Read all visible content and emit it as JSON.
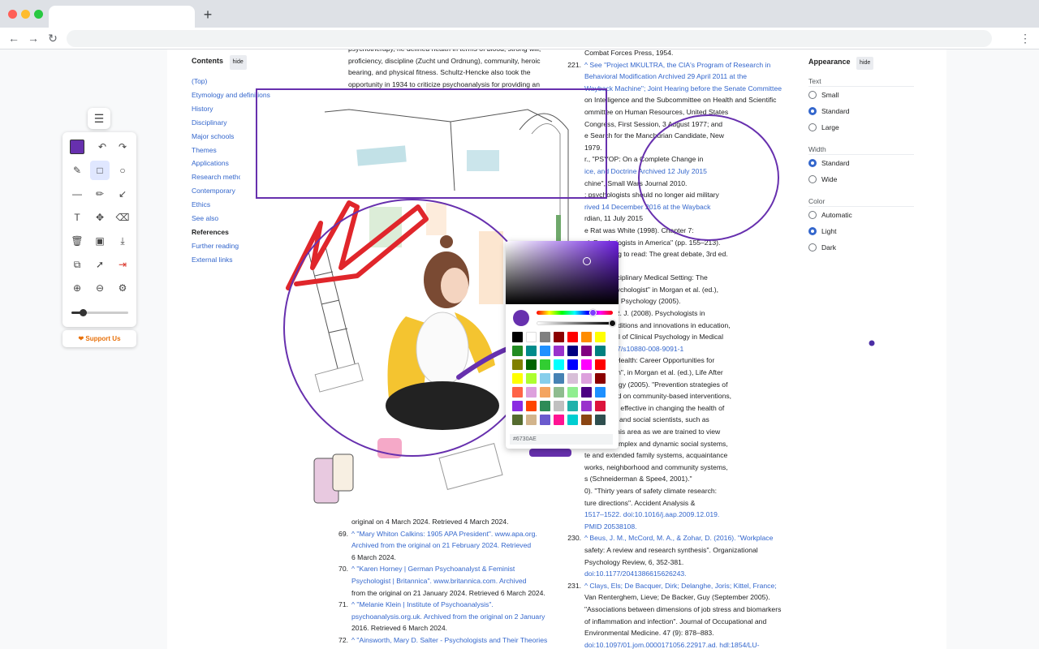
{
  "browser": {
    "new_tab_glyph": "+",
    "back_glyph": "←",
    "forward_glyph": "→",
    "reload_glyph": "↻",
    "menu_glyph": "⋮",
    "dot_colors": [
      "#ff5f57",
      "#febc2e",
      "#28c840"
    ]
  },
  "toc": {
    "title": "Contents",
    "hide_label": "hide",
    "items": [
      {
        "label": "(Top)",
        "chevron": false
      },
      {
        "label": "Etymology and definitions",
        "chevron": false
      },
      {
        "label": "History",
        "chevron": true
      },
      {
        "label": "Disciplinary",
        "chevron": true
      },
      {
        "label": "Major schools",
        "chevron": true
      },
      {
        "label": "Themes",
        "chevron": true
      },
      {
        "label": "Applications",
        "chevron": true
      },
      {
        "label": "Research methods",
        "chevron": true
      },
      {
        "label": "Contemporary",
        "chevron": true
      },
      {
        "label": "Ethics",
        "chevron": true
      },
      {
        "label": "See also",
        "chevron": false
      },
      {
        "label": "References",
        "chevron": true
      },
      {
        "label": "Further reading",
        "chevron": false
      },
      {
        "label": "External links",
        "chevron": false
      }
    ]
  },
  "left_col_top": [
    "psychotherapy, he defined health in terms of blood, strong will,",
    "proficiency, discipline (Zucht und Ordnung), community, heroic",
    "bearing, and physical fitness. Schultz-Hencke also took the",
    "opportunity in 1934 to criticize psychoanalysis for providing an"
  ],
  "left_col_bottom": [
    {
      "num": "",
      "text": "original on 4 March 2024. Retrieved 4 March 2024."
    },
    {
      "num": "69.",
      "text": "^ \"Mary Whiton Calkins: 1905 APA President\". www.apa.org."
    },
    {
      "num": "",
      "text": "Archived from the original on 21 February 2024. Retrieved"
    },
    {
      "num": "",
      "text": "6 March 2024."
    },
    {
      "num": "70.",
      "text": "^ \"Karen Horney | German Psychoanalyst & Feminist"
    },
    {
      "num": "",
      "text": "Psychologist | Britannica\". www.britannica.com. Archived"
    },
    {
      "num": "",
      "text": "from the original on 21 January 2024. Retrieved 6 March 2024."
    },
    {
      "num": "71.",
      "text": "^ \"Melanie Klein | Institute of Psychoanalysis\"."
    },
    {
      "num": "",
      "text": "psychoanalysis.org.uk. Archived from the original on 2 January"
    },
    {
      "num": "",
      "text": "2016. Retrieved 6 March 2024."
    },
    {
      "num": "72.",
      "text": "^ \"Ainsworth, Mary D. Salter - Psychologists and Their Theories"
    }
  ],
  "right_col": [
    {
      "num": "",
      "text": "Combat Forces Press, 1954."
    },
    {
      "num": "221.",
      "text": "^ See \"Project MKULTRA, the CIA's Program of Research in"
    },
    {
      "num": "",
      "text": "Behavioral Modification Archived 29 April 2011 at the"
    },
    {
      "num": "",
      "text": "Wayback Machine\"; Joint Hearing before the Senate Committee"
    },
    {
      "num": "",
      "text": "on Intelligence and the Subcommittee on Health and Scientific"
    },
    {
      "num": "",
      "text": "ommittee on Human Resources, United States"
    },
    {
      "num": "",
      "text": "Congress, First Session, 3 August 1977; and"
    },
    {
      "num": "",
      "text": "e Search for the Manchurian Candidate, New"
    },
    {
      "num": "",
      "text": "1979."
    },
    {
      "num": "",
      "text": "r., \"PSYOP: On a Complete Change in"
    },
    {
      "num": "",
      "text": "ice, and Doctrine Archived 12 July 2015"
    },
    {
      "num": "",
      "text": "chine\", Small Wars Journal 2010."
    },
    {
      "num": "",
      "text": ": psychologists should no longer aid military"
    },
    {
      "num": "",
      "text": "rived 14 December 2016 at the Wayback"
    },
    {
      "num": "",
      "text": "rdian, 11 July 2015"
    },
    {
      "num": "",
      "text": "e Rat was White (1998). Chapter 7:"
    },
    {
      "num": "",
      "text": "ck Psychologists in America\" (pp. 155–213)."
    },
    {
      "num": "",
      "text": "5). Learning to read: The great debate, 3rd ed."
    },
    {
      "num": "",
      "text": "urt Brace."
    },
    {
      "num": "",
      "text": "y, \"Interdisciplinary Medical Setting: The"
    },
    {
      "num": "",
      "text": " Health Psychologist\" in Morgan et al. (ed.),"
    },
    {
      "num": "",
      "text": "e School in Psychology (2005)."
    },
    {
      "num": "",
      "text": "& Seime, R. J. (2008). Psychologists in"
    },
    {
      "num": "",
      "text": "enters: Traditions and innovations in education,"
    },
    {
      "num": "",
      "text": "ice. Journal of Clinical Psychology in Medical"
    },
    {
      "num": "",
      "text": "doi:10.1007/s10880-008-9091-1"
    },
    {
      "num": "",
      "text": "n, \"Public Health: Career Opportunities for"
    },
    {
      "num": "",
      "text": "ublic Health\", in Morgan et al. (ed.), Life After"
    },
    {
      "num": "",
      "text": "n Psychology (2005). \"Prevention strategies of"
    },
    {
      "num": "",
      "text": "oncentrated on community-based interventions,"
    },
    {
      "num": "",
      "text": "hown to be effective in changing the health of"
    },
    {
      "num": "",
      "text": "Behavioral and social scientists, such as"
    },
    {
      "num": "",
      "text": "helpful in this area as we are trained to view"
    },
    {
      "num": "",
      "text": "nging to complex and dynamic social systems,"
    },
    {
      "num": "",
      "text": "te and extended family systems, acquaintance"
    },
    {
      "num": "",
      "text": "works, neighborhood and community systems,"
    },
    {
      "num": "",
      "text": "s (Schneiderman & Spee4, 2001).\""
    },
    {
      "num": "",
      "text": "0). \"Thirty years of safety climate research:"
    },
    {
      "num": "",
      "text": "ture directions\". Accident Analysis &"
    },
    {
      "num": "",
      "text": "1517–1522. doi:10.1016/j.aap.2009.12.019."
    },
    {
      "num": "",
      "text": "PMID 20538108."
    },
    {
      "num": "230.",
      "text": "^ Beus, J. M., McCord, M. A., & Zohar, D. (2016). \"Workplace"
    },
    {
      "num": "",
      "text": "safety: A review and research synthesis\". Organizational"
    },
    {
      "num": "",
      "text": "Psychology Review, 6, 352-381."
    },
    {
      "num": "",
      "text": "doi:10.1177/2041386615626243."
    },
    {
      "num": "231.",
      "text": "^ Clays, Els; De Bacquer, Dirk; Delanghe, Joris; Kittel, France;"
    },
    {
      "num": "",
      "text": "Van Renterghem, Lieve; De Backer, Guy (September 2005)."
    },
    {
      "num": "",
      "text": "\"Associations between dimensions of job stress and biomarkers"
    },
    {
      "num": "",
      "text": "of inflammation and infection\". Journal of Occupational and"
    },
    {
      "num": "",
      "text": "Environmental Medicine. 47 (9): 878–883."
    },
    {
      "num": "",
      "text": "doi:10.1097/01.jom.0000171056.22917.ad. hdl:1854/LU-"
    }
  ],
  "appearance": {
    "title": "Appearance",
    "hide_label": "hide",
    "text_label": "Text",
    "text_options": [
      "Small",
      "Standard",
      "Large"
    ],
    "text_selected": "Standard",
    "width_label": "Width",
    "width_options": [
      "Standard",
      "Wide"
    ],
    "width_selected": "Standard",
    "color_label": "Color",
    "color_options": [
      "Automatic",
      "Light",
      "Dark"
    ],
    "color_selected": "Light"
  },
  "picker": {
    "hex_value": "#6730AE",
    "current_color": "#6730ae",
    "palette": [
      "#000000",
      "#ffffff",
      "#808080",
      "#8b0000",
      "#ff0000",
      "#ff8c00",
      "#ffff00",
      "#228b22",
      "#008b8b",
      "#1e90ff",
      "#9932cc",
      "#000080",
      "#800080",
      "#008080",
      "#808000",
      "#006400",
      "#32cd32",
      "#00ffff",
      "#0000ff",
      "#ff00ff",
      "#ff0000",
      "#ffff00",
      "#adff2f",
      "#87ceeb",
      "#4682b4",
      "#d8bfd8",
      "#dda0dd",
      "#8b0000",
      "#ff6347",
      "#dda0dd",
      "#f4a460",
      "#8fbc8f",
      "#90ee90",
      "#4b0082",
      "#1e90ff",
      "#8a2be2",
      "#ff4500",
      "#2e8b57",
      "#c0c0c0",
      "#20b2aa",
      "#9932cc",
      "#dc143c",
      "#556b2f",
      "#d2b48c",
      "#6a5acd",
      "#ff1493",
      "#00ced1",
      "#8b4513",
      "#2f4f4f"
    ]
  },
  "toolbar": {
    "menu_glyph": "☰",
    "support_label": "Support Us",
    "pen_size_fraction": 0.2,
    "tool_glyphs": {
      "undo": "↶",
      "redo": "↷",
      "highlighter": "✎",
      "rectangle": "□",
      "circle": "○",
      "line": "—",
      "pencil": "✏",
      "arrow": "↙",
      "text": "T",
      "move": "✥",
      "eraser": "⌫",
      "delete": "🗑",
      "image": "▣",
      "download": "⤓",
      "copy": "⧉",
      "select": "➚",
      "exit": "⇥",
      "zoom_in": "⊕",
      "zoom_out": "⊖",
      "settings": "⚙"
    }
  }
}
